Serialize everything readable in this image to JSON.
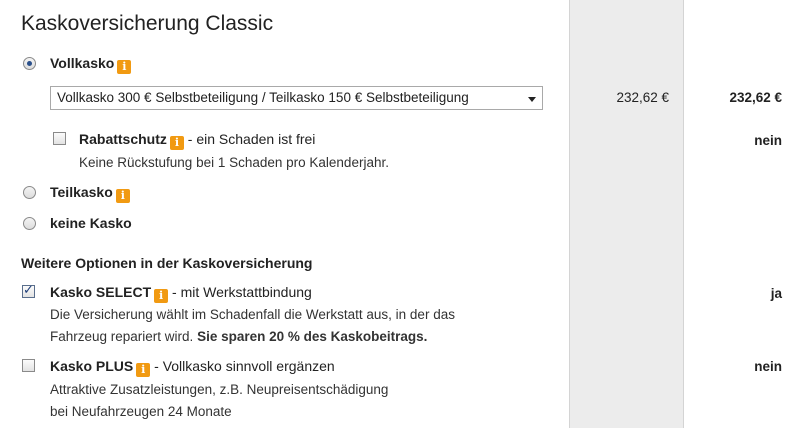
{
  "title": "Kaskoversicherung Classic",
  "vollkasko": {
    "label": "Vollkasko",
    "selected": true,
    "tariff_select": "Vollkasko 300 € Selbstbeteiligung / Teilkasko 150 € Selbstbeteiligung",
    "price_col1": "232,62 €",
    "price_col2": "232,62 €",
    "rabattschutz": {
      "label": "Rabattschutz",
      "suffix": "- ein Schaden ist frei",
      "description": "Keine Rückstufung bei 1 Schaden pro Kalenderjahr.",
      "checked": false,
      "value": "nein"
    }
  },
  "teilkasko": {
    "label": "Teilkasko",
    "selected": false
  },
  "keine_kasko": {
    "label": "keine Kasko",
    "selected": false
  },
  "weitere": {
    "heading": "Weitere Optionen in der Kaskoversicherung",
    "kasko_select": {
      "label": "Kasko SELECT",
      "suffix": "- mit Werkstattbindung",
      "desc_line1": "Die Versicherung wählt im Schadenfall die Werkstatt aus, in der das",
      "desc_line2_normal": "Fahrzeug repariert wird.",
      "desc_line2_bold": "Sie sparen 20 % des Kaskobeitrags.",
      "checked": true,
      "value": "ja"
    },
    "kasko_plus": {
      "label": "Kasko PLUS",
      "suffix": "- Vollkasko sinnvoll ergänzen",
      "desc_line1": "Attraktive Zusatzleistungen, z.B. Neupreisentschädigung",
      "desc_line2": "bei Neufahrzeugen 24 Monate",
      "checked": false,
      "value": "nein"
    }
  },
  "info_icon_glyph": "i",
  "colors": {
    "info_badge": "#f19a12",
    "column_shade": "#ececec"
  }
}
